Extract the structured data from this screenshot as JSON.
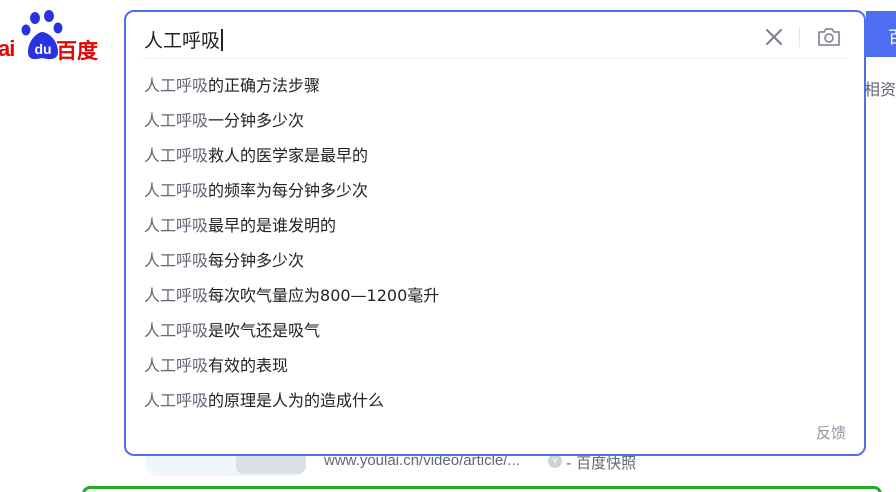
{
  "logo": {
    "text_left": "ai",
    "text_right": "百度",
    "brand_red": "#e10602",
    "brand_blue": "#2932e1",
    "badge_text": "du"
  },
  "search": {
    "query": "人工呼吸",
    "button_label": "百",
    "accent": "#4e6ef2"
  },
  "icons": {
    "clear": "close-icon",
    "camera": "camera-icon"
  },
  "suggestions": [
    {
      "prefix": "人工呼吸",
      "rest": "的正确方法步骤"
    },
    {
      "prefix": "人工呼吸",
      "rest": "一分钟多少次"
    },
    {
      "prefix": "人工呼吸",
      "rest": "救人的医学家是最早的"
    },
    {
      "prefix": "人工呼吸",
      "rest": "的频率为每分钟多少次"
    },
    {
      "prefix": "人工呼吸",
      "rest": "最早的是谁发明的"
    },
    {
      "prefix": "人工呼吸",
      "rest": "每分钟多少次"
    },
    {
      "prefix": "人工呼吸",
      "rest": "每次吹气量应为800—1200毫升"
    },
    {
      "prefix": "人工呼吸",
      "rest": "是吹气还是吸气"
    },
    {
      "prefix": "人工呼吸",
      "rest": "有效的表现"
    },
    {
      "prefix": "人工呼吸",
      "rest": "的原理是人为的造成什么"
    }
  ],
  "feedback_label": "反馈",
  "background": {
    "right_text": "相资讯",
    "result_url": "www.youlai.cn/video/article/...",
    "snapshot_label": "- 百度快照",
    "chevron": "∨",
    "green_accent": "#23a82a"
  }
}
